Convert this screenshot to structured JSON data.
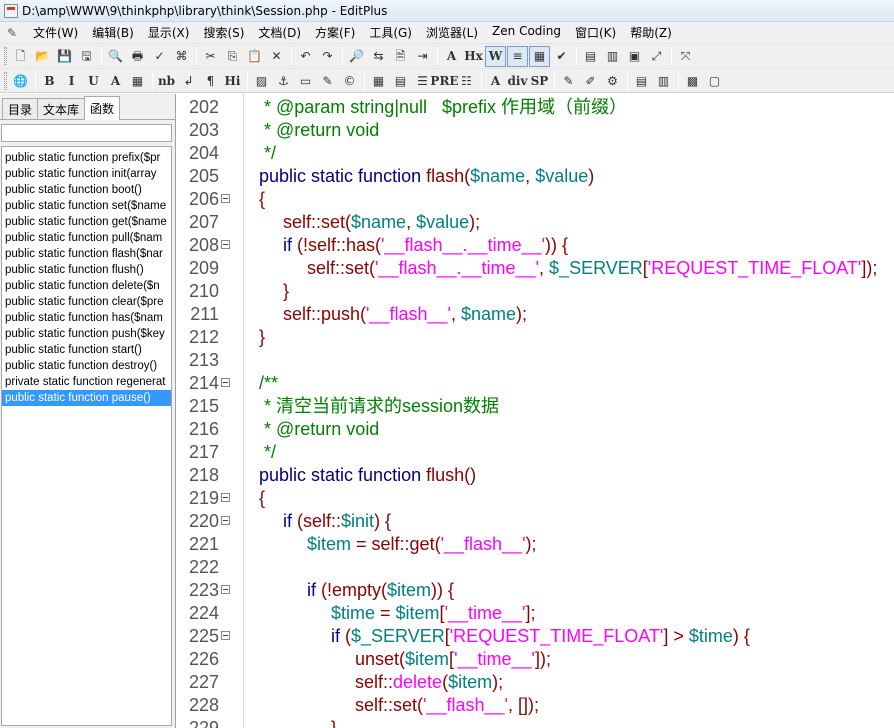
{
  "window": {
    "title": "D:\\amp\\WWW\\9\\thinkphp\\library\\think\\Session.php - EditPlus"
  },
  "menu": [
    {
      "id": "file",
      "label": "文件(W)"
    },
    {
      "id": "edit",
      "label": "编辑(B)"
    },
    {
      "id": "view",
      "label": "显示(X)"
    },
    {
      "id": "search",
      "label": "搜索(S)"
    },
    {
      "id": "document",
      "label": "文档(D)"
    },
    {
      "id": "project",
      "label": "方案(F)"
    },
    {
      "id": "tools",
      "label": "工具(G)"
    },
    {
      "id": "browser",
      "label": "浏览器(L)"
    },
    {
      "id": "zen",
      "label": "Zen Coding"
    },
    {
      "id": "window",
      "label": "窗口(K)"
    },
    {
      "id": "help",
      "label": "帮助(Z)"
    }
  ],
  "toolbar1": [
    {
      "name": "new-file-icon",
      "glyph": "🗋"
    },
    {
      "name": "open-file-icon",
      "glyph": "📂"
    },
    {
      "name": "save-icon",
      "glyph": "💾"
    },
    {
      "name": "save-all-icon",
      "glyph": "🖫"
    },
    {
      "sep": true
    },
    {
      "name": "print-preview-icon",
      "glyph": "🔍"
    },
    {
      "name": "print-icon",
      "glyph": "🖶"
    },
    {
      "name": "spellcheck-icon",
      "glyph": "✓"
    },
    {
      "name": "browser-preview-icon",
      "glyph": "⌘"
    },
    {
      "sep": true
    },
    {
      "name": "cut-icon",
      "glyph": "✂"
    },
    {
      "name": "copy-icon",
      "glyph": "⎘"
    },
    {
      "name": "paste-icon",
      "glyph": "📋"
    },
    {
      "name": "delete-icon",
      "glyph": "✕"
    },
    {
      "sep": true
    },
    {
      "name": "undo-icon",
      "glyph": "↶"
    },
    {
      "name": "redo-icon",
      "glyph": "↷"
    },
    {
      "sep": true
    },
    {
      "name": "find-icon",
      "glyph": "🔎"
    },
    {
      "name": "replace-icon",
      "glyph": "⇆"
    },
    {
      "name": "find-in-files-icon",
      "glyph": "🗎"
    },
    {
      "name": "goto-line-icon",
      "glyph": "⇥"
    },
    {
      "sep": true
    },
    {
      "name": "font-icon",
      "glyph": "A"
    },
    {
      "name": "hex-icon",
      "glyph": "Hx"
    },
    {
      "name": "word-wrap-icon",
      "glyph": "W",
      "pressed": true
    },
    {
      "name": "line-number-icon",
      "glyph": "≡",
      "pressed": true
    },
    {
      "name": "column-marker-icon",
      "glyph": "▦",
      "pressed": true
    },
    {
      "name": "spell-check-icon",
      "glyph": "✔"
    },
    {
      "sep": true
    },
    {
      "name": "cliptext-window-icon",
      "glyph": "▤"
    },
    {
      "name": "directory-window-icon",
      "glyph": "▥"
    },
    {
      "name": "output-window-icon",
      "glyph": "▣"
    },
    {
      "name": "fullscreen-icon",
      "glyph": "⤢"
    },
    {
      "sep": true
    },
    {
      "name": "help-pointer-icon",
      "glyph": "⤧"
    }
  ],
  "toolbar2": [
    {
      "name": "web-browser-icon",
      "glyph": "🌐"
    },
    {
      "sep": true
    },
    {
      "name": "bold-icon",
      "glyph": "B"
    },
    {
      "name": "italic-icon",
      "glyph": "I"
    },
    {
      "name": "underline-icon",
      "glyph": "U"
    },
    {
      "name": "font-color-icon",
      "glyph": "A"
    },
    {
      "name": "color-picker-icon",
      "glyph": "▦"
    },
    {
      "sep": true
    },
    {
      "name": "nbsp-icon",
      "glyph": "nb"
    },
    {
      "name": "line-break-icon",
      "glyph": "↲"
    },
    {
      "name": "paragraph-icon",
      "glyph": "¶"
    },
    {
      "name": "heading-icon",
      "glyph": "Hi"
    },
    {
      "sep": true
    },
    {
      "name": "image-icon",
      "glyph": "▨"
    },
    {
      "name": "anchor-icon",
      "glyph": "⚓"
    },
    {
      "name": "horizontal-rule-icon",
      "glyph": "▭"
    },
    {
      "name": "comment-icon",
      "glyph": "✎"
    },
    {
      "name": "special-char-icon",
      "glyph": "©"
    },
    {
      "sep": true
    },
    {
      "name": "table-icon",
      "glyph": "▦"
    },
    {
      "name": "form-icon",
      "glyph": "▤"
    },
    {
      "name": "center-icon",
      "glyph": "☰"
    },
    {
      "name": "pre-icon",
      "glyph": "PRE"
    },
    {
      "name": "list-icon",
      "glyph": "☷"
    },
    {
      "sep": true
    },
    {
      "name": "font-tag-icon",
      "glyph": "A"
    },
    {
      "name": "div-icon",
      "glyph": "div"
    },
    {
      "name": "span-icon",
      "glyph": "SP"
    },
    {
      "sep": true
    },
    {
      "name": "script-icon",
      "glyph": "✎"
    },
    {
      "name": "style-icon",
      "glyph": "✐"
    },
    {
      "name": "toolbar-misc-icon",
      "glyph": "⚙"
    },
    {
      "sep": true
    },
    {
      "name": "html-toolbar-icon",
      "glyph": "▤"
    },
    {
      "name": "css-toolbar-icon",
      "glyph": "▥"
    },
    {
      "sep": true
    },
    {
      "name": "color-swatch-icon",
      "glyph": "▩"
    },
    {
      "name": "user-toolbar-icon",
      "glyph": "▢"
    }
  ],
  "leftpanel": {
    "tabs": [
      {
        "label": "目录",
        "active": false
      },
      {
        "label": "文本库",
        "active": false
      },
      {
        "label": "函数",
        "active": true
      }
    ],
    "functions": [
      {
        "text": "public static function prefix($pr",
        "selected": false
      },
      {
        "text": "public static function init(array",
        "selected": false
      },
      {
        "text": "public static function boot()",
        "selected": false
      },
      {
        "text": "public static function set($name",
        "selected": false
      },
      {
        "text": "public static function get($name",
        "selected": false
      },
      {
        "text": "public static function pull($nam",
        "selected": false
      },
      {
        "text": "public static function flash($nar",
        "selected": false
      },
      {
        "text": "public static function flush()",
        "selected": false
      },
      {
        "text": "public static function delete($n",
        "selected": false
      },
      {
        "text": "public static function clear($pre",
        "selected": false
      },
      {
        "text": "public static function has($nam",
        "selected": false
      },
      {
        "text": "public static function push($key",
        "selected": false
      },
      {
        "text": "public static function start()",
        "selected": false
      },
      {
        "text": "public static function destroy()",
        "selected": false
      },
      {
        "text": "private static function regenerat",
        "selected": false
      },
      {
        "text": "public static function pause()",
        "selected": true
      }
    ]
  },
  "editor": {
    "lines": [
      {
        "num": "202",
        "fold": false,
        "indent": 0,
        "tokens": [
          [
            "cm",
            " * @param string|null   $prefix 作用域（前缀）"
          ]
        ]
      },
      {
        "num": "203",
        "fold": false,
        "indent": 0,
        "tokens": [
          [
            "cm",
            " * @return void"
          ]
        ]
      },
      {
        "num": "204",
        "fold": false,
        "indent": 0,
        "tokens": [
          [
            "cm",
            " */"
          ]
        ]
      },
      {
        "num": "205",
        "fold": false,
        "indent": 0,
        "tokens": [
          [
            "kw",
            "public static function "
          ],
          [
            "df",
            "flash"
          ],
          [
            "df",
            "("
          ],
          [
            "var",
            "$name"
          ],
          [
            "df",
            ", "
          ],
          [
            "var",
            "$value"
          ],
          [
            "df",
            ")"
          ]
        ]
      },
      {
        "num": "206",
        "fold": true,
        "indent": 0,
        "tokens": [
          [
            "df",
            "{"
          ]
        ]
      },
      {
        "num": "207",
        "fold": false,
        "indent": 1,
        "tokens": [
          [
            "df",
            "self::set("
          ],
          [
            "var",
            "$name"
          ],
          [
            "df",
            ", "
          ],
          [
            "var",
            "$value"
          ],
          [
            "df",
            ");"
          ]
        ]
      },
      {
        "num": "208",
        "fold": true,
        "indent": 1,
        "tokens": [
          [
            "kw",
            "if "
          ],
          [
            "df",
            "(!self::has("
          ],
          [
            "str",
            "'__flash__.__time__'"
          ],
          [
            "df",
            ")) {"
          ]
        ]
      },
      {
        "num": "209",
        "fold": false,
        "indent": 2,
        "tokens": [
          [
            "df",
            "self::set("
          ],
          [
            "str",
            "'__flash__.__time__'"
          ],
          [
            "df",
            ", "
          ],
          [
            "var",
            "$_SERVER"
          ],
          [
            "df",
            "["
          ],
          [
            "str",
            "'REQUEST_TIME_FLOAT'"
          ],
          [
            "df",
            "]);"
          ]
        ]
      },
      {
        "num": "210",
        "fold": false,
        "indent": 1,
        "tokens": [
          [
            "df",
            "}"
          ]
        ]
      },
      {
        "num": "211",
        "fold": false,
        "indent": 1,
        "tokens": [
          [
            "df",
            "self::push("
          ],
          [
            "str",
            "'__flash__'"
          ],
          [
            "df",
            ", "
          ],
          [
            "var",
            "$name"
          ],
          [
            "df",
            ");"
          ]
        ]
      },
      {
        "num": "212",
        "fold": false,
        "indent": 0,
        "tokens": [
          [
            "df",
            "}"
          ]
        ]
      },
      {
        "num": "213",
        "fold": false,
        "indent": 0,
        "tokens": []
      },
      {
        "num": "214",
        "fold": true,
        "indent": 0,
        "tokens": [
          [
            "cm",
            "/**"
          ]
        ]
      },
      {
        "num": "215",
        "fold": false,
        "indent": 0,
        "tokens": [
          [
            "cm",
            " * 清空当前请求的session数据"
          ]
        ]
      },
      {
        "num": "216",
        "fold": false,
        "indent": 0,
        "tokens": [
          [
            "cm",
            " * @return void"
          ]
        ]
      },
      {
        "num": "217",
        "fold": false,
        "indent": 0,
        "tokens": [
          [
            "cm",
            " */"
          ]
        ]
      },
      {
        "num": "218",
        "fold": false,
        "indent": 0,
        "tokens": [
          [
            "kw",
            "public static function "
          ],
          [
            "df",
            "flush()"
          ]
        ]
      },
      {
        "num": "219",
        "fold": true,
        "indent": 0,
        "tokens": [
          [
            "df",
            "{"
          ]
        ]
      },
      {
        "num": "220",
        "fold": true,
        "indent": 1,
        "tokens": [
          [
            "kw",
            "if "
          ],
          [
            "df",
            "(self::"
          ],
          [
            "var",
            "$init"
          ],
          [
            "df",
            ") {"
          ]
        ]
      },
      {
        "num": "221",
        "fold": false,
        "indent": 2,
        "tokens": [
          [
            "var",
            "$item"
          ],
          [
            "df",
            " = self::get("
          ],
          [
            "str",
            "'__flash__'"
          ],
          [
            "df",
            ");"
          ]
        ]
      },
      {
        "num": "222",
        "fold": false,
        "indent": 0,
        "tokens": []
      },
      {
        "num": "223",
        "fold": true,
        "indent": 2,
        "tokens": [
          [
            "kw",
            "if "
          ],
          [
            "df",
            "(!empty("
          ],
          [
            "var",
            "$item"
          ],
          [
            "df",
            ")) {"
          ]
        ]
      },
      {
        "num": "224",
        "fold": false,
        "indent": 3,
        "tokens": [
          [
            "var",
            "$time"
          ],
          [
            "df",
            " = "
          ],
          [
            "var",
            "$item"
          ],
          [
            "df",
            "["
          ],
          [
            "str",
            "'__time__'"
          ],
          [
            "df",
            "];"
          ]
        ]
      },
      {
        "num": "225",
        "fold": true,
        "indent": 3,
        "tokens": [
          [
            "kw",
            "if "
          ],
          [
            "df",
            "("
          ],
          [
            "var",
            "$_SERVER"
          ],
          [
            "df",
            "["
          ],
          [
            "str",
            "'REQUEST_TIME_FLOAT'"
          ],
          [
            "df",
            "] > "
          ],
          [
            "var",
            "$time"
          ],
          [
            "df",
            ") {"
          ]
        ]
      },
      {
        "num": "226",
        "fold": false,
        "indent": 4,
        "tokens": [
          [
            "df",
            "unset("
          ],
          [
            "var",
            "$item"
          ],
          [
            "df",
            "["
          ],
          [
            "str",
            "'__time__'"
          ],
          [
            "df",
            "]);"
          ]
        ]
      },
      {
        "num": "227",
        "fold": false,
        "indent": 4,
        "tokens": [
          [
            "df",
            "self::"
          ],
          [
            "str2",
            "delete"
          ],
          [
            "df",
            "("
          ],
          [
            "var",
            "$item"
          ],
          [
            "df",
            ");"
          ]
        ]
      },
      {
        "num": "228",
        "fold": false,
        "indent": 4,
        "tokens": [
          [
            "df",
            "self::set("
          ],
          [
            "str",
            "'__flash__'"
          ],
          [
            "df",
            ", []);"
          ]
        ]
      },
      {
        "num": "229",
        "fold": false,
        "indent": 3,
        "tokens": [
          [
            "df",
            "}"
          ]
        ]
      }
    ]
  }
}
